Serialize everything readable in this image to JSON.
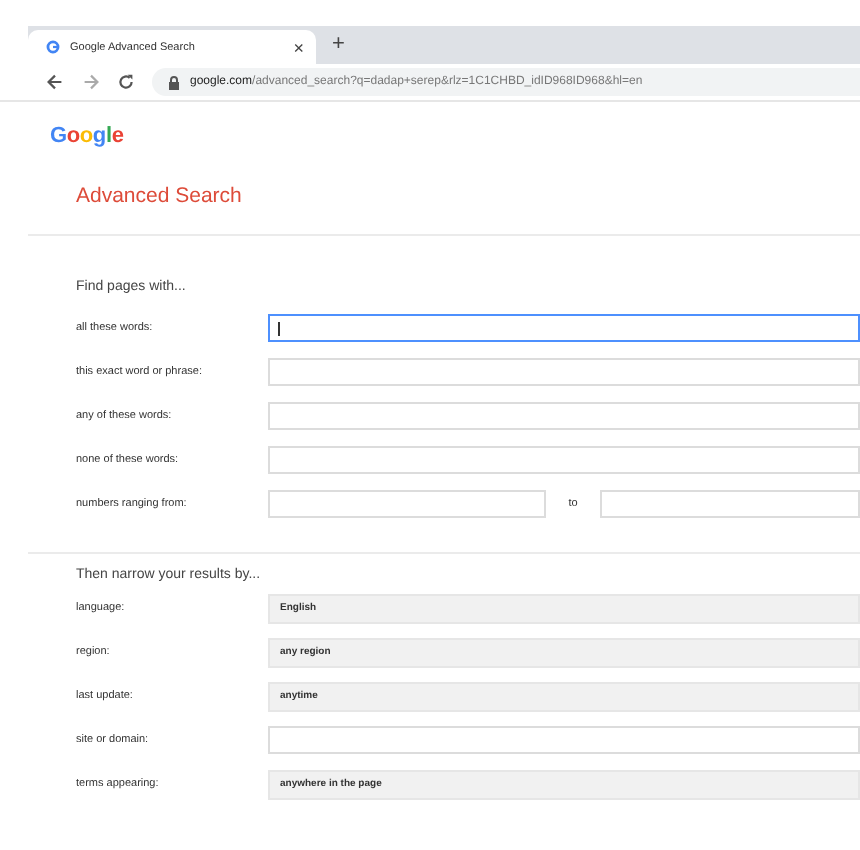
{
  "browser": {
    "tab": {
      "title": "Google Advanced Search",
      "close": "×",
      "selected": true
    },
    "new_tab": "+",
    "url_domain": "google.com",
    "url_path": "/advanced_search?q=dadap+serep&rlz=1C1CHBD_idID968ID968&hl=en"
  },
  "logo": "Google",
  "heading": "Advanced Search",
  "find_section": {
    "title": "Find pages with...",
    "rows": [
      {
        "label": "all these words:",
        "kind": "text",
        "focused": true
      },
      {
        "label": "this exact word or phrase:",
        "kind": "text",
        "focused": false
      },
      {
        "label": "any of these words:",
        "kind": "text",
        "focused": false
      },
      {
        "label": "none of these words:",
        "kind": "text",
        "focused": false
      },
      {
        "label": "numbers ranging from:",
        "kind": "range",
        "focused": false,
        "between": "to"
      }
    ]
  },
  "narrow_section": {
    "title": "Then narrow your results by...",
    "rows": [
      {
        "label": "language:",
        "kind": "select",
        "value": "English"
      },
      {
        "label": "region:",
        "kind": "select",
        "value": "any region"
      },
      {
        "label": "last update:",
        "kind": "select",
        "value": "anytime"
      },
      {
        "label": "site or domain:",
        "kind": "text"
      },
      {
        "label": "terms appearing:",
        "kind": "select",
        "value": "anywhere in the page"
      }
    ]
  }
}
